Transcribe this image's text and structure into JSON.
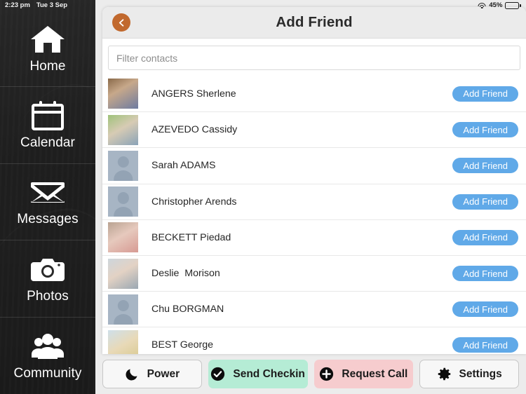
{
  "statusbar": {
    "time": "2:23 pm",
    "date": "Tue 3 Sep",
    "wifi_icon": "wifi-icon",
    "battery_percent": "45%",
    "battery_icon": "battery-icon"
  },
  "sidebar": {
    "items": [
      {
        "label": "Home",
        "icon": "home-icon"
      },
      {
        "label": "Calendar",
        "icon": "calendar-icon"
      },
      {
        "label": "Messages",
        "icon": "envelope-icon"
      },
      {
        "label": "Photos",
        "icon": "camera-icon"
      },
      {
        "label": "Community",
        "icon": "people-group-icon"
      }
    ]
  },
  "card": {
    "title": "Add Friend",
    "back_icon": "chevron-left-icon",
    "filter": {
      "placeholder": "Filter contacts",
      "value": ""
    },
    "add_button_label": "Add Friend",
    "contacts": [
      {
        "name": "ANGERS Sherlene",
        "avatar": "photo",
        "action": "Add Friend"
      },
      {
        "name": "AZEVEDO Cassidy",
        "avatar": "photo",
        "action": "Add Friend"
      },
      {
        "name": "Sarah ADAMS",
        "avatar": "placeholder",
        "action": "Add Friend"
      },
      {
        "name": "Christopher Arends",
        "avatar": "placeholder",
        "action": "Add Friend"
      },
      {
        "name": "BECKETT Piedad",
        "avatar": "photo",
        "action": "Add Friend"
      },
      {
        "name": "Deslie  Morison",
        "avatar": "photo",
        "action": "Add Friend"
      },
      {
        "name": "Chu BORGMAN",
        "avatar": "placeholder",
        "action": "Add Friend"
      },
      {
        "name": "BEST George",
        "avatar": "photo",
        "action": "Add Friend"
      }
    ]
  },
  "bottombar": {
    "buttons": [
      {
        "label": "Power",
        "icon": "moon-icon",
        "style": "plain"
      },
      {
        "label": "Send Checkin",
        "icon": "check-circle-icon",
        "style": "green"
      },
      {
        "label": "Request Call",
        "icon": "plus-circle-icon",
        "style": "pink"
      },
      {
        "label": "Settings",
        "icon": "gear-icon",
        "style": "plain"
      }
    ]
  },
  "colors": {
    "accent_blue": "#60a9e8",
    "back_orange": "#c1692e",
    "checkin_green": "#b5ecd5",
    "request_pink": "#f6ccce",
    "sidebar_dark": "#2e2e2e"
  }
}
